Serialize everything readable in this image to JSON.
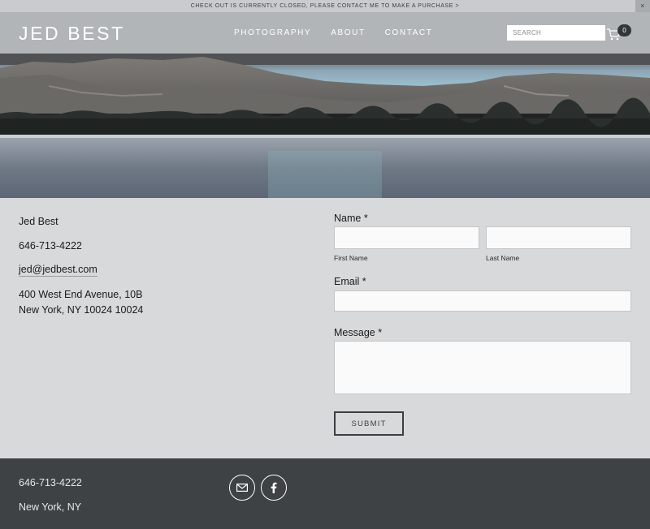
{
  "announcement": {
    "text": "CHECK OUT IS CURRENTLY CLOSED, PLEASE CONTACT ME TO MAKE A PURCHASE >",
    "close_label": "×"
  },
  "header": {
    "logo": "JED BEST",
    "nav": [
      "PHOTOGRAPHY",
      "ABOUT",
      "CONTACT"
    ],
    "search_placeholder": "SEARCH",
    "cart_count": "0"
  },
  "contact": {
    "name": "Jed Best",
    "phone": "646-713-4222",
    "email": "jed@jedbest.com",
    "address_line1": "400 West End Avenue, 10B",
    "address_line2": "New York, NY 10024 10024"
  },
  "form": {
    "name_label": "Name *",
    "first_name_label": "First Name",
    "last_name_label": "Last Name",
    "email_label": "Email *",
    "message_label": "Message *",
    "submit_label": "SUBMIT"
  },
  "footer": {
    "phone": "646-713-4222",
    "location": "New York, NY",
    "social_icons": [
      "mail-icon",
      "facebook-icon"
    ]
  },
  "colors": {
    "header_bg": "#b2b5b8",
    "page_bg": "#d8d9da",
    "footer_bg": "#3e4245",
    "announcement_bg": "#c9cbcd"
  }
}
